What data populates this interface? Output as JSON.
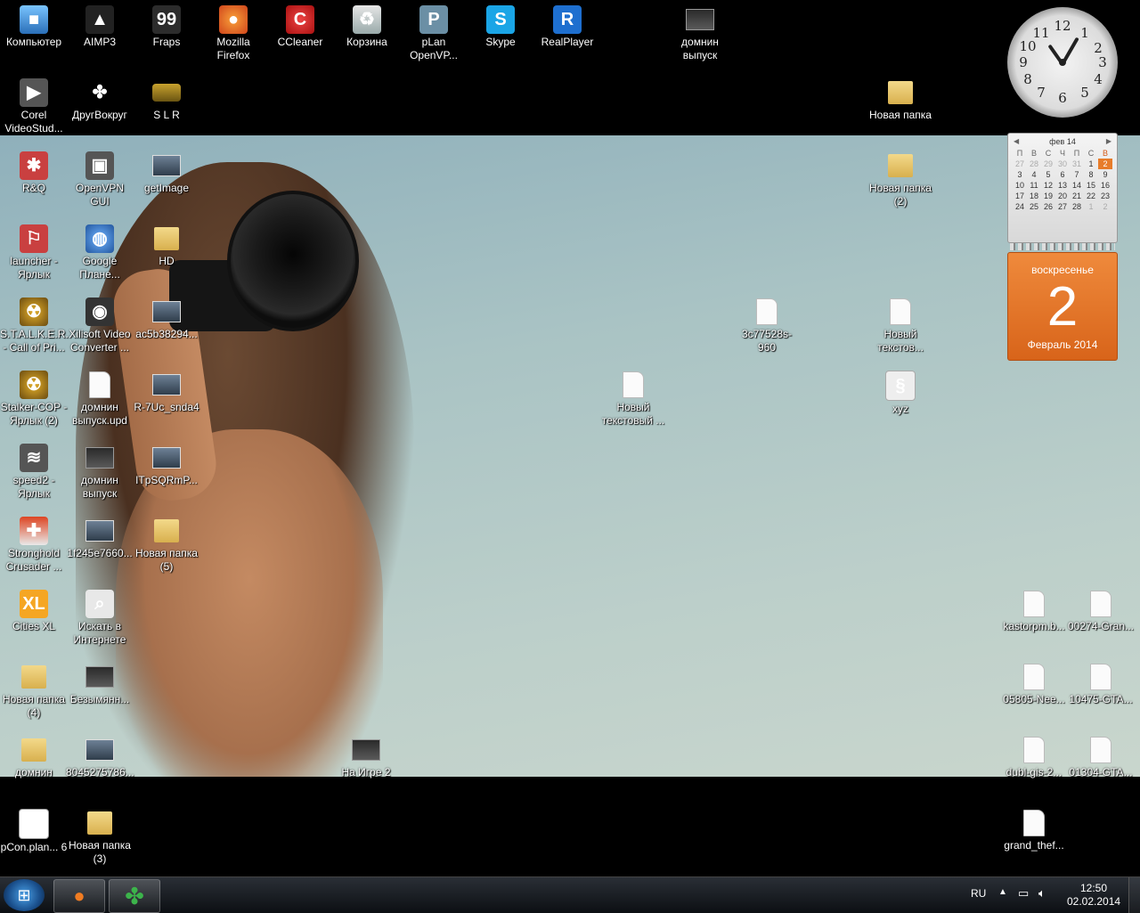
{
  "desktop_icons": [
    {
      "label": "Компьютер",
      "icon": "computer-icon"
    },
    {
      "label": "AIMP3",
      "icon": "aimp-icon"
    },
    {
      "label": "Fraps",
      "icon": "fraps-icon",
      "badge": "99"
    },
    {
      "label": "Mozilla Firefox",
      "icon": "firefox-icon"
    },
    {
      "label": "CCleaner",
      "icon": "ccleaner-icon"
    },
    {
      "label": "Корзина",
      "icon": "recycle-bin-icon"
    },
    {
      "label": "pLan OpenVP...",
      "icon": "plan-openvpn-icon"
    },
    {
      "label": "Skype",
      "icon": "skype-icon"
    },
    {
      "label": "RealPlayer",
      "icon": "realplayer-icon"
    },
    {
      "label": "домнин выпуск",
      "icon": "image-file-icon"
    },
    {
      "label": "Corel VideoStud...",
      "icon": "corel-icon"
    },
    {
      "label": "ДругВокруг",
      "icon": "clover-icon"
    },
    {
      "label": "S L R",
      "icon": "car-icon"
    },
    {
      "label": "Новая папка",
      "icon": "folder-icon"
    },
    {
      "label": "R&Q",
      "icon": "rq-icon"
    },
    {
      "label": "OpenVPN GUI",
      "icon": "openvpn-icon"
    },
    {
      "label": "getImage",
      "icon": "image-file-icon"
    },
    {
      "label": "Новая папка (2)",
      "icon": "folder-icon"
    },
    {
      "label": "launcher - Ярлык",
      "icon": "launcher-icon"
    },
    {
      "label": "Google Плане...",
      "icon": "google-earth-icon"
    },
    {
      "label": "HD",
      "icon": "folder-icon"
    },
    {
      "label": "S.T.A.L.K.E.R. - Call of Pri...",
      "icon": "stalker-icon"
    },
    {
      "label": "Xilisoft Video Converter ...",
      "icon": "xilisoft-icon"
    },
    {
      "label": "ac5b38294...",
      "icon": "image-file-icon"
    },
    {
      "label": "3c77528s-960",
      "icon": "image-file-icon"
    },
    {
      "label": "Новый текстов...",
      "icon": "text-file-icon"
    },
    {
      "label": "Stalker-COP - Ярлык (2)",
      "icon": "stalker-icon"
    },
    {
      "label": "домнин выпуск.upd",
      "icon": "document-icon"
    },
    {
      "label": "R-7Uc_snda4",
      "icon": "image-file-icon"
    },
    {
      "label": "Новый текстовый ...",
      "icon": "text-file-icon"
    },
    {
      "label": "xyz",
      "icon": "script-file-icon"
    },
    {
      "label": "speed2 - Ярлык",
      "icon": "speed2-icon"
    },
    {
      "label": "домнин выпуск",
      "icon": "image-file-icon"
    },
    {
      "label": "ITpSQRmP...",
      "icon": "image-file-icon"
    },
    {
      "label": "Stronghold Crusader ...",
      "icon": "stronghold-icon"
    },
    {
      "label": "1f245e7660...",
      "icon": "image-file-icon"
    },
    {
      "label": "Новая папка (5)",
      "icon": "folder-icon"
    },
    {
      "label": "Cities XL",
      "icon": "cities-xl-icon"
    },
    {
      "label": "Искать в Интернете",
      "icon": "search-internet-icon"
    },
    {
      "label": "Новая папка (4)",
      "icon": "folder-icon"
    },
    {
      "label": "Безымянн...",
      "icon": "image-file-icon"
    },
    {
      "label": "домнин",
      "icon": "folder-icon"
    },
    {
      "label": "8045275786...",
      "icon": "image-file-icon"
    },
    {
      "label": "На Игре 2",
      "icon": "image-file-icon"
    },
    {
      "label": "pCon.plan... 6",
      "icon": "pcon-icon"
    },
    {
      "label": "Новая папка (3)",
      "icon": "folder-icon"
    },
    {
      "label": "kastorpm.b...",
      "icon": "document-icon"
    },
    {
      "label": "00274-Gran...",
      "icon": "document-icon"
    },
    {
      "label": "05805-Nee...",
      "icon": "document-icon"
    },
    {
      "label": "10475-GTA...",
      "icon": "document-icon"
    },
    {
      "label": "dubl-gis-2...",
      "icon": "document-icon"
    },
    {
      "label": "01304-GTA...",
      "icon": "document-icon"
    },
    {
      "label": "grand_thef...",
      "icon": "document-icon"
    }
  ],
  "clock": {
    "numbers": [
      "12",
      "1",
      "2",
      "3",
      "4",
      "5",
      "6",
      "7",
      "8",
      "9",
      "10",
      "11"
    ],
    "time": "12:50"
  },
  "calendar": {
    "month_label": "фев 14",
    "weekday_headers": [
      "П",
      "В",
      "С",
      "Ч",
      "П",
      "С",
      "В"
    ],
    "weeks": [
      [
        "27",
        "28",
        "29",
        "30",
        "31",
        "1",
        "2"
      ],
      [
        "3",
        "4",
        "5",
        "6",
        "7",
        "8",
        "9"
      ],
      [
        "10",
        "11",
        "12",
        "13",
        "14",
        "15",
        "16"
      ],
      [
        "17",
        "18",
        "19",
        "20",
        "21",
        "22",
        "23"
      ],
      [
        "24",
        "25",
        "26",
        "27",
        "28",
        "1",
        "2"
      ]
    ],
    "today": "2",
    "weekday": "воскресенье",
    "month_year": "Февраль 2014",
    "accent": "#e77c2a"
  },
  "taskbar": {
    "language": "RU",
    "time": "12:50",
    "date": "02.02.2014",
    "pinned": [
      {
        "name": "firefox-icon"
      },
      {
        "name": "clover-icon"
      }
    ]
  }
}
